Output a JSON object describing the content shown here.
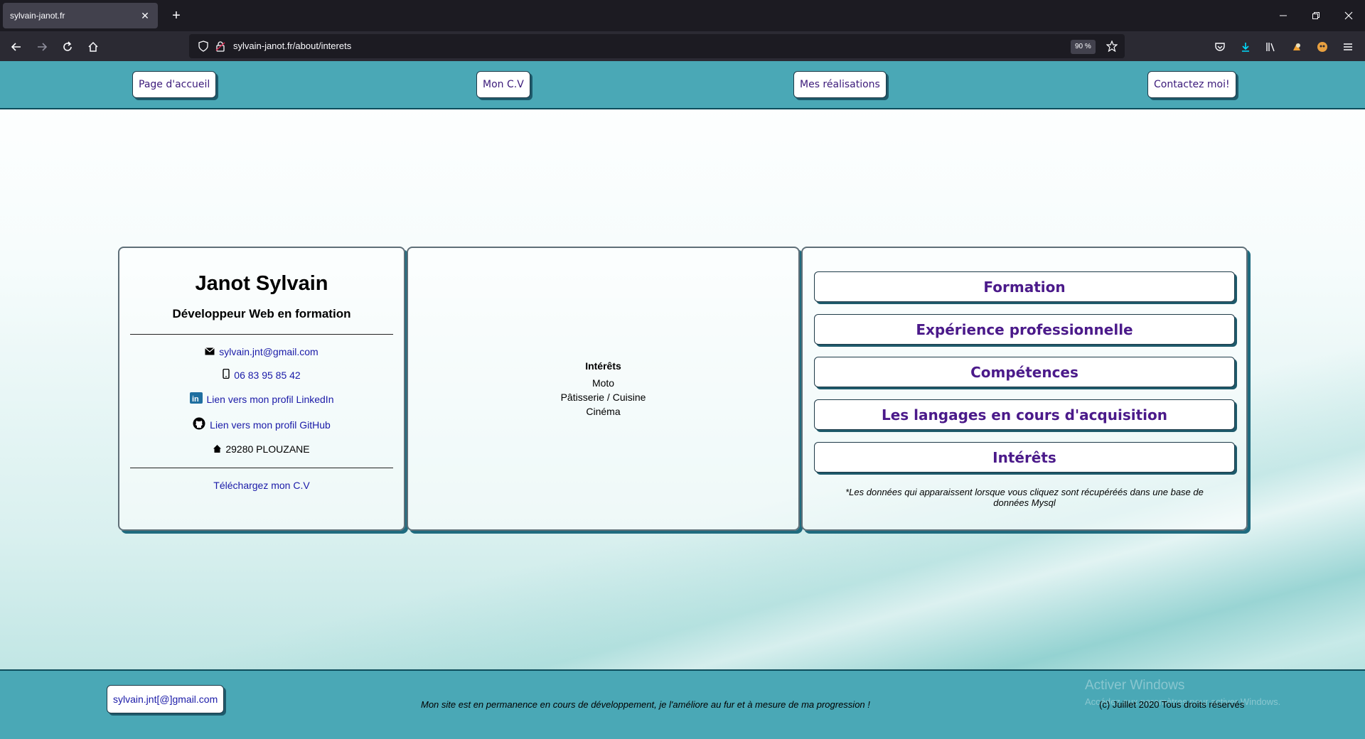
{
  "browser": {
    "tab_title": "sylvain-janot.fr",
    "url": "sylvain-janot.fr/about/interets",
    "zoom": "90 %"
  },
  "header": {
    "home": "Page d'accueil",
    "cv": "Mon C.V",
    "works": "Mes réalisations",
    "contact": "Contactez moi!"
  },
  "profile": {
    "name": "Janot Sylvain",
    "role": "Développeur Web en formation",
    "email": "sylvain.jnt@gmail.com",
    "phone": "06 83 95 85 42",
    "linkedin": "Lien vers mon profil LinkedIn",
    "github": "Lien vers mon profil GitHub",
    "address": "29280 PLOUZANE",
    "download": "Téléchargez mon C.V"
  },
  "content": {
    "title": "Intérêts",
    "items": [
      "Moto",
      "Pâtisserie / Cuisine",
      "Cinéma"
    ]
  },
  "menu": {
    "buttons": [
      "Formation",
      "Expérience professionnelle",
      "Compétences",
      "Les langages en cours d'acquisition",
      "Intérêts"
    ],
    "note": "*Les données qui apparaissent lorsque vous cliquez sont récupéréés dans une base de données Mysql"
  },
  "footer": {
    "email_button": "sylvain.jnt[@]gmail.com",
    "message": "Mon site est en permanence en cours de développement, je l'améliore au fur et à mesure de ma progression !",
    "copyright": "(c) Juillet 2020 Tous droits réservés",
    "watermark_title": "Activer Windows",
    "watermark_sub": "Accédez aux paramètres pour activer Windows."
  }
}
